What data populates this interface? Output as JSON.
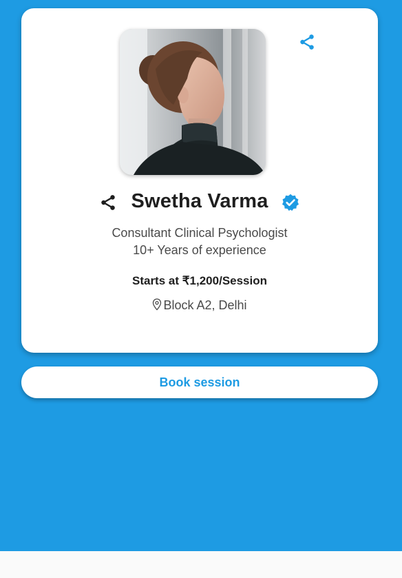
{
  "profile": {
    "name": "Swetha Varma",
    "title": "Consultant Clinical Psychologist",
    "experience": "10+ Years of experience",
    "price": "Starts at ₹1,200/Session",
    "location": "Block A2, Delhi",
    "verified": true
  },
  "actions": {
    "book_label": "Book session"
  },
  "icons": {
    "share_top": "share-icon",
    "share_left": "share-icon",
    "verified": "verified-badge-icon",
    "location": "location-pin-icon"
  },
  "colors": {
    "background": "#1e9be3",
    "accent": "#1e9be3",
    "card": "#ffffff",
    "text_dark": "#1f1f1f",
    "text_muted": "#4a4a4a"
  }
}
